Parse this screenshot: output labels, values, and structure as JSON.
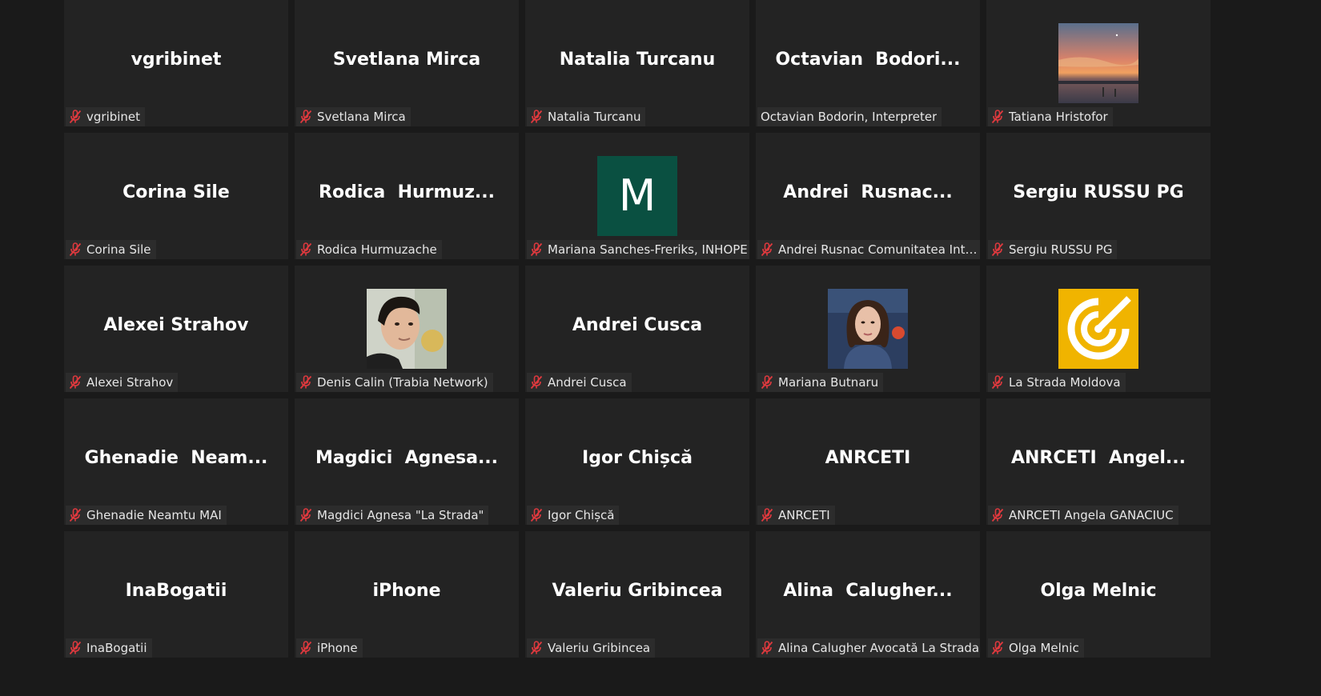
{
  "colors": {
    "background": "#1a1a1a",
    "tile": "#232323",
    "label_bg": "#2c2c2c",
    "muted_mic": "#e0393e",
    "avatar_m": "#0a5041",
    "avatar_strada": "#f0b400"
  },
  "participants": [
    {
      "display": "vgribinet",
      "label": "vgribinet",
      "muted": true,
      "avatar": "none"
    },
    {
      "display": "Svetlana Mirca",
      "label": "Svetlana Mirca",
      "muted": true,
      "avatar": "none"
    },
    {
      "display": "Natalia Turcanu",
      "label": "Natalia Turcanu",
      "muted": true,
      "avatar": "none"
    },
    {
      "display": "Octavian  Bodori...",
      "label": "Octavian Bodorin, Interpreter",
      "muted": false,
      "avatar": "none"
    },
    {
      "display": "",
      "label": "Tatiana Hristofor",
      "muted": true,
      "avatar": "sunset-photo"
    },
    {
      "display": "Corina Sile",
      "label": "Corina Sile",
      "muted": true,
      "avatar": "none"
    },
    {
      "display": "Rodica  Hurmuz...",
      "label": "Rodica Hurmuzache",
      "muted": true,
      "avatar": "none"
    },
    {
      "display": "",
      "label": "Mariana Sanches-Freriks, INHOPE",
      "muted": true,
      "avatar": "letter",
      "avatar_letter": "M"
    },
    {
      "display": "Andrei  Rusnac...",
      "label": "Andrei Rusnac Comunitatea Intern...",
      "muted": true,
      "avatar": "none"
    },
    {
      "display": "Sergiu RUSSU PG",
      "label": "Sergiu RUSSU PG",
      "muted": true,
      "avatar": "none"
    },
    {
      "display": "Alexei Strahov",
      "label": "Alexei Strahov",
      "muted": true,
      "avatar": "none"
    },
    {
      "display": "",
      "label": "Denis Calin (Trabia Network)",
      "muted": true,
      "avatar": "man-photo"
    },
    {
      "display": "Andrei Cusca",
      "label": "Andrei Cusca",
      "muted": true,
      "avatar": "none"
    },
    {
      "display": "",
      "label": "Mariana Butnaru",
      "muted": true,
      "avatar": "woman-photo"
    },
    {
      "display": "",
      "label": "La Strada Moldova",
      "muted": true,
      "avatar": "strada-logo"
    },
    {
      "display": "Ghenadie  Neam...",
      "label": "Ghenadie Neamtu MAI",
      "muted": true,
      "avatar": "none"
    },
    {
      "display": "Magdici  Agnesa...",
      "label": "Magdici Agnesa \"La Strada\"",
      "muted": true,
      "avatar": "none"
    },
    {
      "display": "Igor Chișcă",
      "label": "Igor Chișcă",
      "muted": true,
      "avatar": "none"
    },
    {
      "display": "ANRCETI",
      "label": "ANRCETI",
      "muted": true,
      "avatar": "none"
    },
    {
      "display": "ANRCETI  Angel...",
      "label": "ANRCETI Angela GANACIUC",
      "muted": true,
      "avatar": "none"
    },
    {
      "display": "InaBogatii",
      "label": "InaBogatii",
      "muted": true,
      "avatar": "none"
    },
    {
      "display": "iPhone",
      "label": "iPhone",
      "muted": true,
      "avatar": "none"
    },
    {
      "display": "Valeriu Gribincea",
      "label": "Valeriu Gribincea",
      "muted": true,
      "avatar": "none"
    },
    {
      "display": "Alina  Calugher...",
      "label": "Alina Calugher Avocată La Strada",
      "muted": true,
      "avatar": "none"
    },
    {
      "display": "Olga Melnic",
      "label": "Olga Melnic",
      "muted": true,
      "avatar": "none"
    }
  ]
}
